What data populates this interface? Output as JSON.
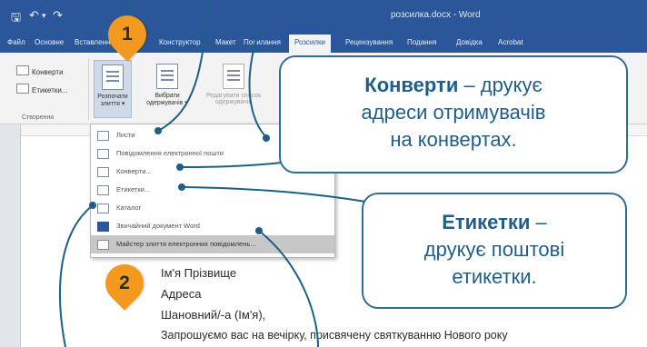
{
  "titlebar": {
    "document_title": "розсилка.docx - Word"
  },
  "tabs": [
    "Файл",
    "Основне",
    "Вставлення",
    "Конструктор",
    "Макет",
    "Посилання",
    "Розсилки",
    "Рецензування",
    "Подання",
    "Довідка",
    "Acrobat"
  ],
  "ribbon": {
    "envelopes": "Конверти",
    "labels": "Етикетки...",
    "group_create": "Створення",
    "start_merge": [
      "Розпочати",
      "злиття ▾"
    ],
    "select_recipients": [
      "Вибрати",
      "одержувачів ▾"
    ],
    "edit_recipients": [
      "Редагувати список",
      "одержувачів"
    ]
  },
  "menu": {
    "items": [
      "Листи",
      "Повідомлення електронної пошти",
      "Конверти...",
      "Етикетки...",
      "Каталог",
      "Звичайний документ Word",
      "Майстер злиття електронних повідомлень..."
    ]
  },
  "document": {
    "lines": [
      "Ім'я Прізвище",
      "Адреса",
      "Шановний/-а (Ім'я),",
      "Запрошуємо вас на вечірку, присвячену святкуванню Нового року"
    ]
  },
  "callouts": {
    "envelopes": {
      "title": "Конверти",
      "text_1": " – друкує",
      "text_2": "адреси отримувачів",
      "text_3": "на конвертах."
    },
    "labels": {
      "title": "Етикетки",
      "text_1": " –",
      "text_2": "друкує поштові",
      "text_3": "етикетки."
    }
  },
  "badges": {
    "one": "1",
    "two": "2"
  },
  "colors": {
    "word_blue": "#2b579a",
    "callout_text": "#1f5e8b",
    "badge": "#f39a1e"
  }
}
